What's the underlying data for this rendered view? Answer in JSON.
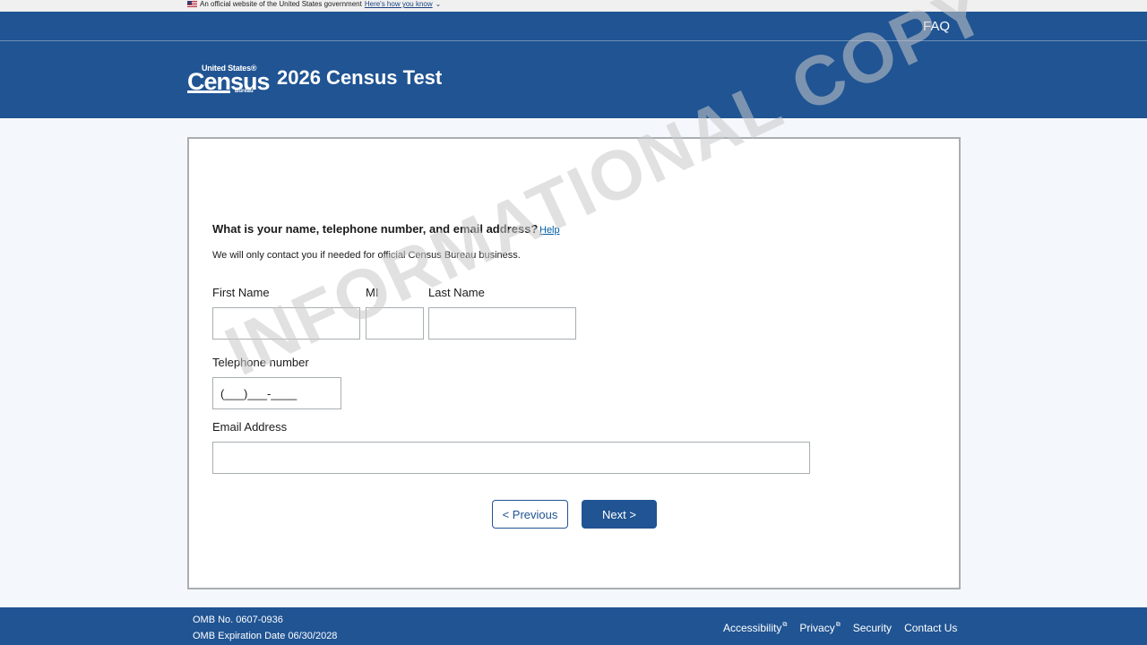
{
  "gov_banner": {
    "text": "An official website of the United States government",
    "link": "Here's how you know"
  },
  "header": {
    "faq": "FAQ",
    "logo_top": "United States®",
    "logo_main": "Census",
    "logo_bureau": "Bureau",
    "title": "2026 Census Test"
  },
  "form": {
    "question": "What is your name, telephone number, and email address?",
    "help": "Help",
    "note": "We will only contact you if needed for official Census Bureau business.",
    "first_name_label": "First Name",
    "mi_label": "MI",
    "last_name_label": "Last Name",
    "phone_label": "Telephone number",
    "phone_placeholder": "(___)___-____",
    "email_label": "Email Address",
    "previous": "< Previous",
    "next": "Next >"
  },
  "watermark": "INFORMATIONAL COPY",
  "footer": {
    "omb_number": "OMB No. 0607-0936",
    "omb_expiration": "OMB Expiration Date 06/30/2028",
    "links": [
      "Accessibility",
      "Privacy",
      "Security",
      "Contact Us"
    ]
  },
  "colors": {
    "brand_blue": "#205493",
    "link_blue": "#005ea2"
  }
}
